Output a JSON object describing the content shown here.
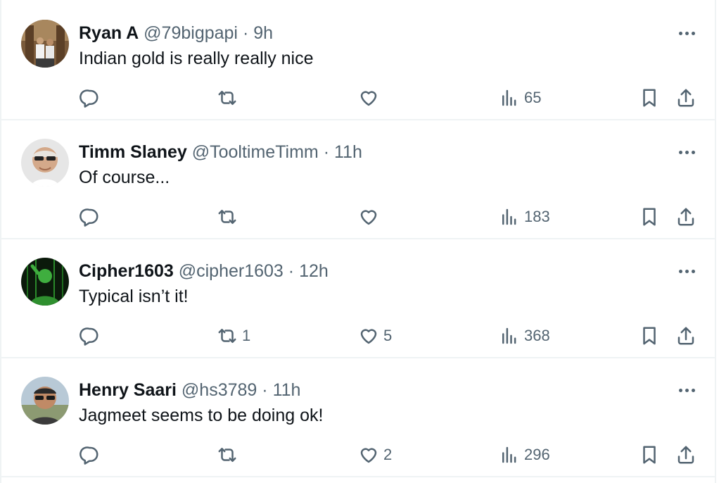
{
  "tweets": [
    {
      "name": "Ryan A",
      "handle": "@79bigpapi",
      "separator": "·",
      "time": "9h",
      "text": "Indian gold is really really nice",
      "replies": "",
      "retweets": "",
      "likes": "",
      "views": "65",
      "avatar": "photo-two-people-indoors"
    },
    {
      "name": "Timm Slaney",
      "handle": "@TooltimeTimm",
      "separator": "·",
      "time": "11h",
      "text": "Of course...",
      "replies": "",
      "retweets": "",
      "likes": "",
      "views": "183",
      "avatar": "photo-man-with-sunglasses"
    },
    {
      "name": "Cipher1603",
      "handle": "@cipher1603",
      "separator": "·",
      "time": "12h",
      "text": "Typical isn’t it!",
      "replies": "",
      "retweets": "1",
      "likes": "5",
      "views": "368",
      "avatar": "green-matrix-figure"
    },
    {
      "name": "Henry Saari",
      "handle": "@hs3789",
      "separator": "·",
      "time": "11h",
      "text": "Jagmeet seems to be doing ok!",
      "replies": "",
      "retweets": "",
      "likes": "2",
      "views": "296",
      "avatar": "photo-man-with-sunglasses-outdoors"
    }
  ],
  "icons": {
    "reply": "reply-icon",
    "retweet": "retweet-icon",
    "like": "heart-icon",
    "views": "views-chart-icon",
    "bookmark": "bookmark-icon",
    "share": "share-icon",
    "more": "more-icon"
  },
  "colors": {
    "text_primary": "#0f1419",
    "text_secondary": "#536471",
    "divider": "#eff3f4",
    "background": "#ffffff"
  }
}
